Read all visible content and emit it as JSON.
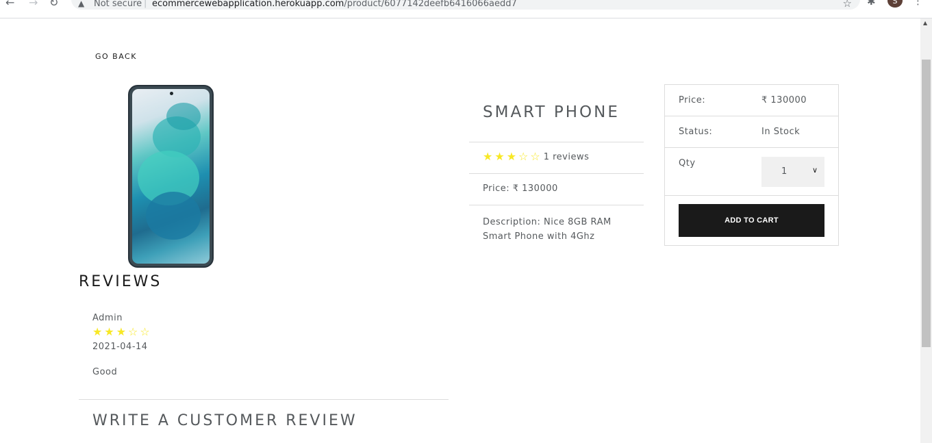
{
  "browser": {
    "security_label": "Not secure",
    "separator": "|",
    "url_host": "ecommercewebapplication.herokuapp.com",
    "url_path": "/product/6077142deefb6416066aedd7",
    "profile_initial": "S"
  },
  "nav": {
    "go_back_label": "GO BACK"
  },
  "product": {
    "name": "SMART PHONE",
    "rating": 3,
    "max_rating": 5,
    "reviews_count_label": "1 reviews",
    "price_label": "Price: ₹ 130000",
    "description_label": "Description: Nice 8GB RAM Smart Phone with 4Ghz"
  },
  "purchase_card": {
    "price_label": "Price:",
    "price_value": "₹ 130000",
    "status_label": "Status:",
    "status_value": "In Stock",
    "qty_label": "Qty",
    "qty_value": "1",
    "add_to_cart_label": "ADD TO CART"
  },
  "reviews": {
    "title": "REVIEWS",
    "items": [
      {
        "name": "Admin",
        "rating": 3,
        "date": "2021-04-14",
        "comment": "Good"
      }
    ],
    "write_review_title": "WRITE A CUSTOMER REVIEW"
  },
  "colors": {
    "star": "#f8e825",
    "button_bg": "#1a1a1a",
    "text": "#55595c"
  }
}
